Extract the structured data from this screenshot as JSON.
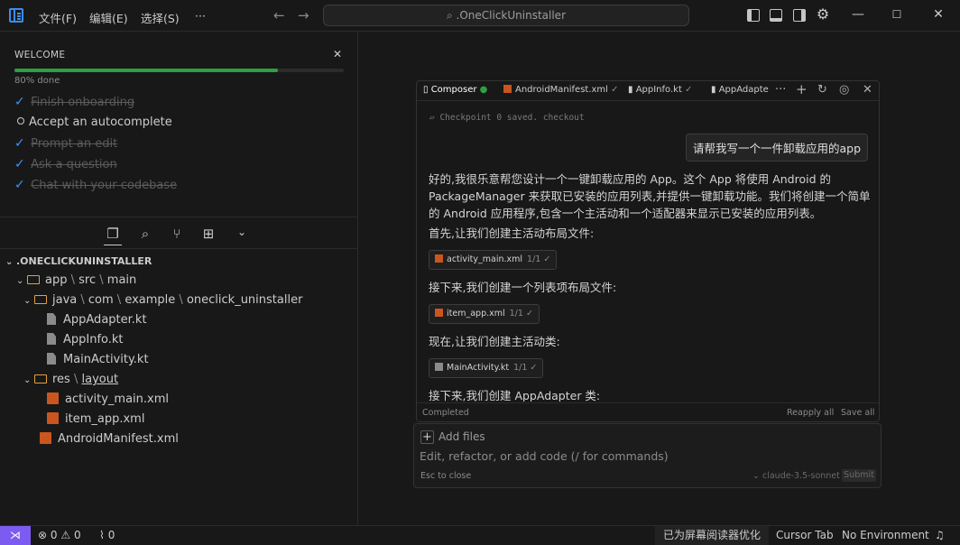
{
  "menu": {
    "file": "文件(F)",
    "edit": "编辑(E)",
    "selection": "选择(S)",
    "more": "···"
  },
  "search": {
    "text": ".OneClickUninstaller"
  },
  "welcome": {
    "title": "WELCOME",
    "progress_text": "80% done",
    "progress_fraction": 0.8,
    "items": [
      {
        "label": "Finish onboarding",
        "done": true
      },
      {
        "label": "Accept an autocomplete",
        "done": false
      },
      {
        "label": "Prompt an edit",
        "done": true
      },
      {
        "label": "Ask a question",
        "done": true
      },
      {
        "label": "Chat with your codebase",
        "done": true
      }
    ]
  },
  "explorer": {
    "root": ".ONECLICKUNINSTALLER",
    "app": "app",
    "src": "src",
    "main": "main",
    "java": "java",
    "com": "com",
    "example": "example",
    "pkg": "oneclick_uninstaller",
    "kt_files": [
      "AppAdapter.kt",
      "AppInfo.kt",
      "MainActivity.kt"
    ],
    "res": "res",
    "layout": "layout",
    "xml_files": [
      "activity_main.xml",
      "item_app.xml"
    ],
    "manifest": "AndroidManifest.xml"
  },
  "composer": {
    "tabs": [
      {
        "label": "Composer",
        "mark": "●"
      },
      {
        "label": "AndroidManifest.xml",
        "mark": "✓"
      },
      {
        "label": "AppInfo.kt",
        "mark": "✓"
      },
      {
        "label": "AppAdapte",
        "mark": ""
      }
    ],
    "checkpoint": "Checkpoint 0 saved. checkout",
    "user_message": "请帮我写一个一件卸载应用的app",
    "intro": "好的,我很乐意帮您设计一个一键卸载应用的 App。这个 App 将使用 Android 的 PackageManager 来获取已安装的应用列表,并提供一键卸载功能。我们将创建一个简单的 Android 应用程序,包含一个主活动和一个适配器来显示已安装的应用列表。",
    "step1": "首先,让我们创建主活动布局文件:",
    "chip1": {
      "name": "activity_main.xml",
      "count": "1/1"
    },
    "step2": "接下来,我们创建一个列表项布局文件:",
    "chip2": {
      "name": "item_app.xml",
      "count": "1/1"
    },
    "step3": "现在,让我们创建主活动类:",
    "chip3": {
      "name": "MainActivity.kt",
      "count": "1/1"
    },
    "step4": "接下来,我们创建 AppAdapter 类:",
    "status": "Completed",
    "reapply": "Reapply all",
    "save": "Save all"
  },
  "input": {
    "add_files": "Add files",
    "placeholder": "Edit, refactor, or add code (/ for commands)",
    "esc_hint": "Esc to close",
    "model": "claude-3.5-sonnet",
    "submit": "Submit"
  },
  "status": {
    "errors": "0",
    "warnings": "0",
    "ports": "0",
    "screen_reader": "已为屏幕阅读器优化",
    "cursor_tab": "Cursor Tab",
    "environment": "No Environment"
  },
  "colors": {
    "accent": "#3794ff",
    "progress": "#2ea043",
    "remote": "#7c5cf0",
    "folder": "#e2a03f",
    "xml": "#c9561e"
  }
}
